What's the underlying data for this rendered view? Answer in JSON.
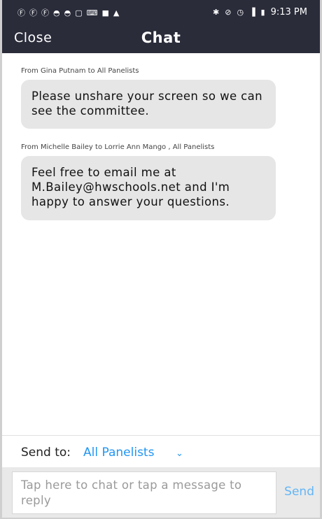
{
  "status_bar": {
    "left_icons": [
      "facebook-icon",
      "facebook-icon",
      "facebook-icon",
      "messenger-icon",
      "messenger-icon",
      "chat-icon",
      "keyboard-icon",
      "video-icon",
      "notification-icon"
    ],
    "right_icons": [
      "bluetooth-icon",
      "mute-icon",
      "alarm-icon",
      "signal-icon",
      "battery-icon"
    ],
    "time": "9:13 PM"
  },
  "header": {
    "close_label": "Close",
    "title": "Chat"
  },
  "messages": [
    {
      "from": "From Gina Putnam to All Panelists",
      "text": "Please unshare your screen so we can see the committee."
    },
    {
      "from": "From Michelle Bailey  to Lorrie Ann Mango , All Panelists",
      "text": "Feel free to email me at M.Bailey@hwschools.net and I'm happy to answer your questions."
    }
  ],
  "send_to": {
    "label": "Send to:",
    "value": "All Panelists"
  },
  "composer": {
    "placeholder": "Tap here to chat or tap a message to reply",
    "send_label": "Send"
  },
  "colors": {
    "header_bg": "#2a2c3a",
    "accent": "#2196f3",
    "bubble_bg": "#e6e6e6"
  }
}
